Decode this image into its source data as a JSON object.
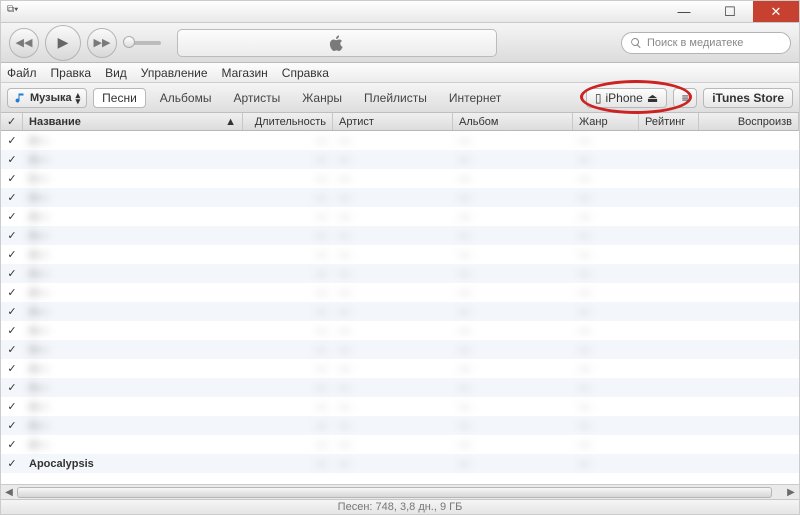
{
  "window": {
    "sys_icon": "⧉▾"
  },
  "search": {
    "placeholder": "Поиск в медиатеке"
  },
  "menubar": [
    "Файл",
    "Правка",
    "Вид",
    "Управление",
    "Магазин",
    "Справка"
  ],
  "navbar": {
    "library_label": "Музыка",
    "tabs": [
      "Песни",
      "Альбомы",
      "Артисты",
      "Жанры",
      "Плейлисты",
      "Интернет"
    ],
    "device_label": "iPhone",
    "store_label": "iTunes Store"
  },
  "columns": {
    "name": "Название",
    "duration": "Длительность",
    "artist": "Артист",
    "album": "Альбом",
    "genre": "Жанр",
    "rating": "Рейтинг",
    "plays": "Воспроизв"
  },
  "rows": [
    {
      "checked": true,
      "name": "A—",
      "dur": "—",
      "artist": "—",
      "album": "—",
      "genre": "—"
    },
    {
      "checked": true,
      "name": "A—",
      "dur": "—",
      "artist": "—",
      "album": "—",
      "genre": "—"
    },
    {
      "checked": true,
      "name": "C—",
      "dur": "—",
      "artist": "—",
      "album": "—",
      "genre": "—"
    },
    {
      "checked": true,
      "name": "A—",
      "dur": "—",
      "artist": "—",
      "album": "—",
      "genre": "—"
    },
    {
      "checked": true,
      "name": "A—",
      "dur": "—",
      "artist": "—",
      "album": "—",
      "genre": "—"
    },
    {
      "checked": true,
      "name": "A—",
      "dur": "—",
      "artist": "—",
      "album": "—",
      "genre": "—"
    },
    {
      "checked": true,
      "name": "A—",
      "dur": "—",
      "artist": "—",
      "album": "—",
      "genre": "—"
    },
    {
      "checked": true,
      "name": "A—",
      "dur": "—",
      "artist": "—",
      "album": "—",
      "genre": "—"
    },
    {
      "checked": true,
      "name": "A—",
      "dur": "—",
      "artist": "—",
      "album": "—",
      "genre": "—"
    },
    {
      "checked": true,
      "name": "A—",
      "dur": "—",
      "artist": "—",
      "album": "—",
      "genre": "—"
    },
    {
      "checked": true,
      "name": "A—",
      "dur": "—",
      "artist": "—",
      "album": "—",
      "genre": "—"
    },
    {
      "checked": true,
      "name": "A—",
      "dur": "—",
      "artist": "—",
      "album": "—",
      "genre": "—"
    },
    {
      "checked": true,
      "name": "A—",
      "dur": "—",
      "artist": "—",
      "album": "—",
      "genre": "—"
    },
    {
      "checked": true,
      "name": "A—",
      "dur": "—",
      "artist": "—",
      "album": "—",
      "genre": "—"
    },
    {
      "checked": true,
      "name": "A—",
      "dur": "—",
      "artist": "—",
      "album": "—",
      "genre": "—"
    },
    {
      "checked": true,
      "name": "A—",
      "dur": "—",
      "artist": "—",
      "album": "—",
      "genre": "—"
    },
    {
      "checked": true,
      "name": "A—",
      "dur": "—",
      "artist": "—",
      "album": "—",
      "genre": "—"
    },
    {
      "checked": true,
      "name": "Apocalypsis",
      "dur": "—",
      "artist": "—",
      "album": "—",
      "genre": "—"
    }
  ],
  "status": "Песен: 748, 3,8 дн., 9 ГБ"
}
